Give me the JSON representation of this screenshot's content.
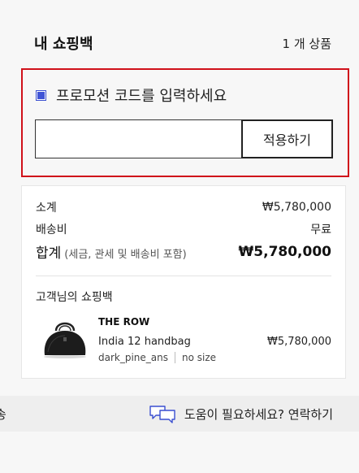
{
  "header": {
    "title": "내 쇼핑백",
    "item_count": "1 개 상품"
  },
  "promo": {
    "label": "프로모션 코드를 입력하세요",
    "input_value": "",
    "input_placeholder": "",
    "apply_label": "적용하기",
    "highlight_color": "#d0111a"
  },
  "summary": {
    "subtotal_label": "소계",
    "subtotal_value": "₩5,780,000",
    "shipping_label": "배송비",
    "shipping_value": "무료",
    "total_label": "합계",
    "total_note": "(세금, 관세 및 배송비 포함)",
    "total_value": "₩5,780,000"
  },
  "bag": {
    "title": "고객님의 쇼핑백",
    "items": [
      {
        "brand": "THE ROW",
        "name": "India 12 handbag",
        "color": "dark_pine_ans",
        "size": "no size",
        "price": "₩5,780,000",
        "image": "black-handbag"
      }
    ]
  },
  "help": {
    "left_fragment": "송",
    "text": "도움이 필요하세요? 연락하기",
    "icon": "chat-bubbles-icon"
  }
}
